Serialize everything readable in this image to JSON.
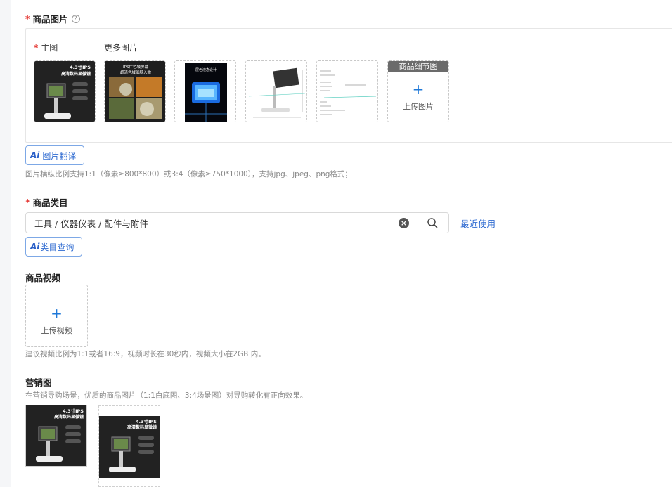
{
  "product_images": {
    "title": "商品图片",
    "help_glyph": "?",
    "main_label": "主图",
    "more_label": "更多图片",
    "thumb1": {
      "line1": "4.3寸IPS",
      "line2": "高清数码显微镜"
    },
    "thumb2": {
      "line1": "IPS广色域屏幕",
      "line2": "超清色域细腻入微"
    },
    "thumb3": {
      "line1": "层色液态设计"
    },
    "detail_tile": {
      "header": "商品细节图",
      "plus": "+",
      "upload_label": "上传图片"
    },
    "ai_translate": {
      "ai": "Ai",
      "label": "图片翻译"
    },
    "hint": "图片横纵比例支持1:1（像素≥800*800）或3:4（像素≥750*1000），支持jpg、jpeg、png格式；"
  },
  "category": {
    "title": "商品类目",
    "value": "工具 / 仪器仪表 / 配件与附件",
    "clear_glyph": "×",
    "recent_link": "最近使用",
    "ai_query": {
      "ai": "Ai",
      "label": "类目查询"
    }
  },
  "video": {
    "title": "商品视频",
    "plus": "+",
    "upload_label": "上传视频",
    "hint": "建议视频比例为1:1或者16:9，视频时长在30秒内，视频大小在2GB 内。"
  },
  "marketing": {
    "title": "营销图",
    "hint": "在营销导购场景，优质的商品图片（1:1白底图、3:4场景图）对导购转化有正向效果。",
    "img1": {
      "line1": "4.3寸IPS",
      "line2": "高清数码显微镜"
    },
    "img2": {
      "line1": "4.3寸IPS",
      "line2": "高清数码显微镜"
    }
  },
  "colors": {
    "accent": "#2f6bd1",
    "required": "#e53935"
  },
  "icons": [
    "help-icon",
    "plus-icon",
    "clear-icon",
    "search-icon"
  ]
}
